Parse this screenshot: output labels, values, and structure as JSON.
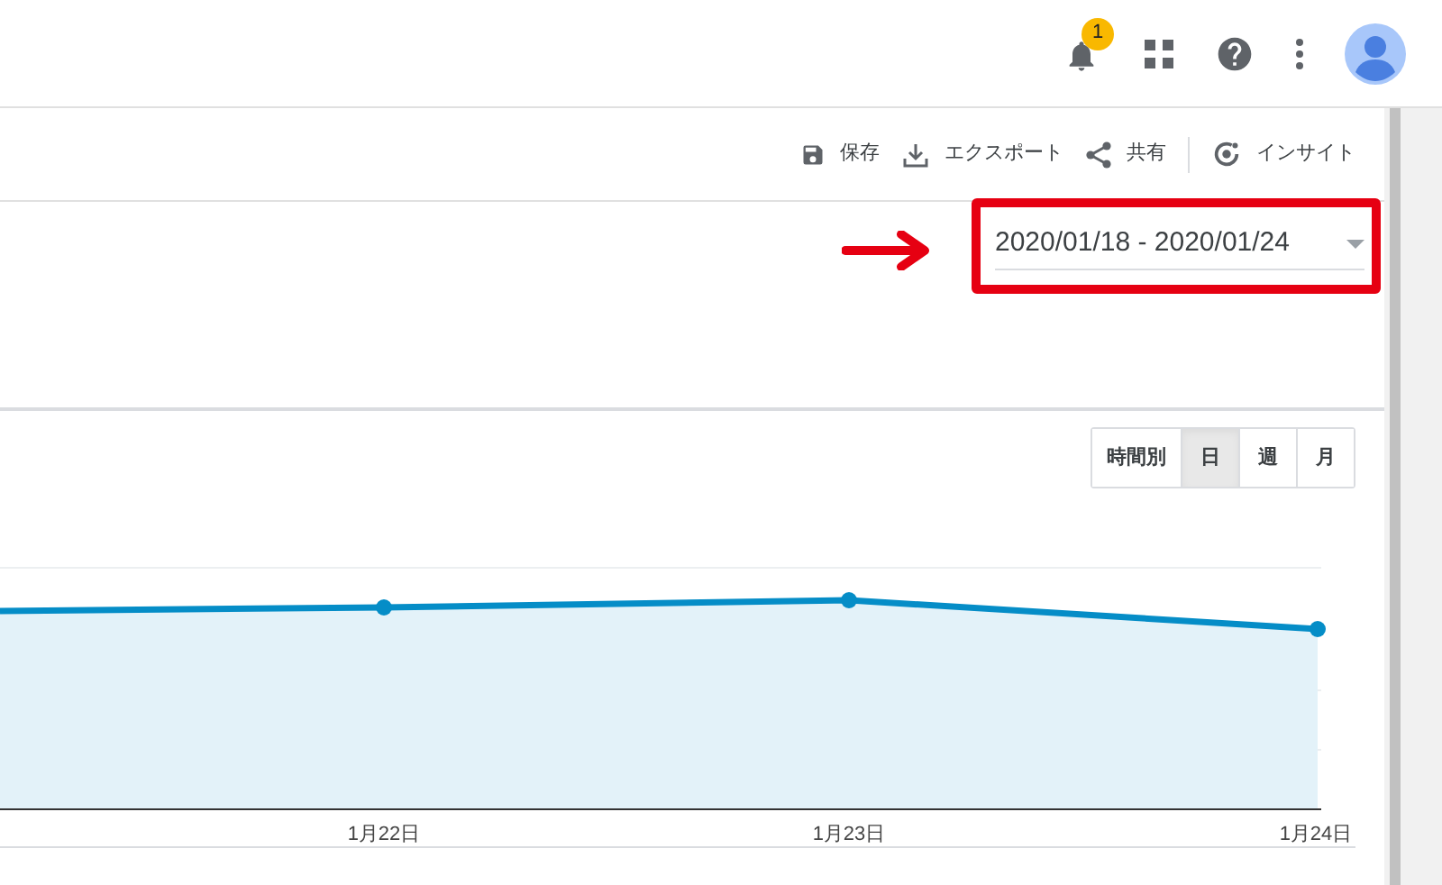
{
  "top_bar": {
    "notification_count": "1"
  },
  "toolbar": {
    "actions": [
      {
        "kind": "save",
        "label": "保存"
      },
      {
        "kind": "export",
        "label": "エクスポート"
      },
      {
        "kind": "share",
        "label": "共有"
      },
      {
        "kind": "insight",
        "label": "インサイト"
      }
    ]
  },
  "date_range": {
    "value": "2020/01/18 - 2020/01/24"
  },
  "granularity": [
    {
      "label": "時間別",
      "selected": false
    },
    {
      "label": "日",
      "selected": true
    },
    {
      "label": "週",
      "selected": false
    },
    {
      "label": "月",
      "selected": false
    }
  ],
  "chart": {
    "x_labels": [
      "1月22日",
      "1月23日",
      "1月24日"
    ]
  }
}
